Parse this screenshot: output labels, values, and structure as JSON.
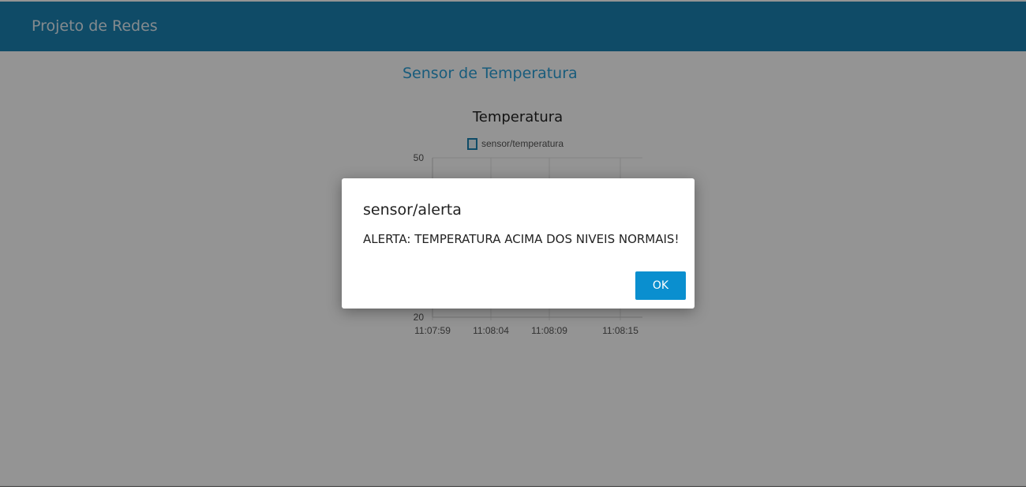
{
  "header": {
    "title": "Projeto de Redes",
    "bg_color": "#1a82b2"
  },
  "card": {
    "title": "Sensor de Temperatura"
  },
  "chart_data": {
    "type": "line",
    "title": "Temperatura",
    "legend": "top",
    "grid": true,
    "series": [
      {
        "name": "sensor/temperatura",
        "color": "#1a82b2"
      }
    ],
    "y_ticks": [
      "20",
      "50"
    ],
    "ylim": [
      20,
      50
    ],
    "x_ticks": [
      "11:07:59",
      "11:08:04",
      "11:08:09",
      "11:08:15"
    ]
  },
  "modal": {
    "title": "sensor/alerta",
    "message": "ALERTA: TEMPERATURA ACIMA DOS NIVEIS NORMAIS!",
    "ok_label": "OK",
    "ok_color": "#0a8fcf"
  }
}
